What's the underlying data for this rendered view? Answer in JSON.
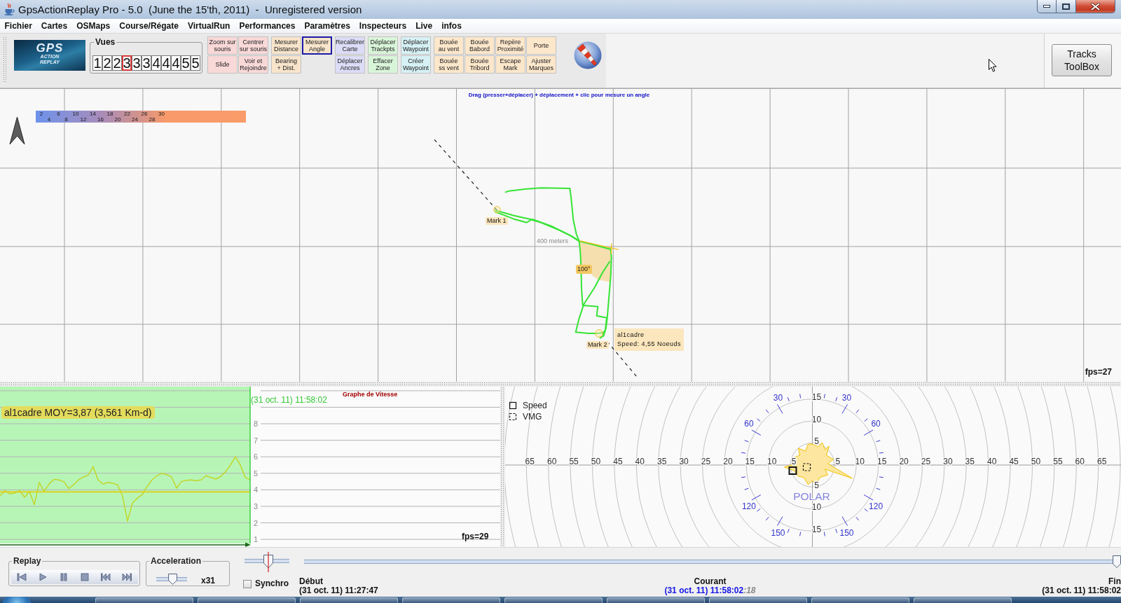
{
  "window": {
    "title": "GpsActionReplay Pro - 5.0  (June the 15'th, 2011)  -  Unregistered version"
  },
  "menu": [
    "Fichier",
    "Cartes",
    "OSMaps",
    "Course/Régate",
    "VirtualRun",
    "Performances",
    "Paramètres",
    "Inspecteurs",
    "Live",
    "infos"
  ],
  "toolbar": {
    "logo": {
      "title": "GPS",
      "subtitle": "ACTION\nREPLAY"
    },
    "views": {
      "label": "Vues",
      "buttons": [
        {
          "label": "1",
          "selected": false
        },
        {
          "label": "2",
          "selected": false
        },
        {
          "label": "2",
          "selected": false
        },
        {
          "label": "3",
          "selected": true
        },
        {
          "label": "3",
          "selected": false
        },
        {
          "label": "3",
          "selected": false
        },
        {
          "label": "4",
          "selected": false
        },
        {
          "label": "4",
          "selected": false
        },
        {
          "label": "4",
          "selected": false
        },
        {
          "label": "5",
          "selected": false
        },
        {
          "label": "5",
          "selected": false
        }
      ]
    },
    "tool_groups": [
      {
        "color": "#f9d8d8",
        "columns": [
          [
            {
              "label": "Zoom sur\nsouris",
              "selected": false
            },
            {
              "label": "Slide",
              "selected": false
            }
          ],
          [
            {
              "label": "Centrer\nsur souris",
              "selected": false
            },
            {
              "label": "Voir et\nRejoindre",
              "selected": false
            }
          ]
        ]
      },
      {
        "color": "#f7e4cb",
        "columns": [
          [
            {
              "label": "Mesurer\nDistance",
              "selected": false
            },
            {
              "label": "Bearing\n+ Dist.",
              "selected": false
            }
          ],
          [
            {
              "label": "Mesurer\nAngle",
              "selected": true
            }
          ]
        ]
      },
      {
        "color": "#dcdcf7",
        "columns": [
          [
            {
              "label": "Recalibrer\nCarte",
              "selected": false
            },
            {
              "label": "Déplacer\nAncres",
              "selected": false
            }
          ]
        ]
      },
      {
        "color": "#d9f5d9",
        "columns": [
          [
            {
              "label": "Déplacer\nTrackpts",
              "selected": false
            },
            {
              "label": "Effacer\nZone",
              "selected": false
            }
          ]
        ]
      },
      {
        "color": "#d6f1f5",
        "columns": [
          [
            {
              "label": "Déplacer\nWaypoint",
              "selected": false
            },
            {
              "label": "Créer\nWaypoint",
              "selected": false
            }
          ]
        ]
      },
      {
        "color": "#fce7cb",
        "columns": [
          [
            {
              "label": "Bouée\nau vent",
              "selected": false
            },
            {
              "label": "Bouée\nss vent",
              "selected": false
            }
          ],
          [
            {
              "label": "Bouée\nBabord",
              "selected": false
            },
            {
              "label": "Bouée\nTribord",
              "selected": false
            }
          ],
          [
            {
              "label": "Repère\nProximité",
              "selected": false
            },
            {
              "label": "Escape\nMark",
              "selected": false
            }
          ],
          [
            {
              "label": "Porte",
              "selected": false
            },
            {
              "label": "Ajuster\nMarques",
              "selected": false
            }
          ]
        ]
      }
    ],
    "toolbox_button": "Tracks\nToolBox"
  },
  "map": {
    "hint": "Drag (presser+déplacer) + déplacement + clic pour mesure un angle",
    "speed_legend": {
      "upper_row": [
        "2",
        "6",
        "10",
        "14",
        "18",
        "22",
        "26",
        "30"
      ],
      "lower_row": [
        "4",
        "8",
        "12",
        "16",
        "20",
        "24",
        "28"
      ]
    },
    "marks": [
      {
        "label": "Mark 1"
      },
      {
        "label": "Mark 2"
      }
    ],
    "scale_label": "400 meters",
    "angle_label": "100°",
    "tooltip": {
      "name": "al1cadre",
      "speed": "Speed: 4,55 Noeuds"
    },
    "fps": "fps=27"
  },
  "speed_graph": {
    "title": "Graphe de Vitesse",
    "label": "al1cadre MOY=3,87 (3,561 Km-d)",
    "time": "(31 oct. 11) 11:58:02",
    "fps": "fps=29",
    "chart_data": {
      "type": "line",
      "grid": true,
      "ylim": [
        0.75,
        10.25
      ],
      "yticks": [
        {
          "value": 1,
          "label": "1"
        },
        {
          "value": 2,
          "label": "2"
        },
        {
          "value": 3,
          "label": "3"
        },
        {
          "value": 4,
          "label": "4"
        },
        {
          "value": 5,
          "label": "5"
        },
        {
          "value": 6,
          "label": "6"
        },
        {
          "value": 7,
          "label": "7"
        },
        {
          "value": 8,
          "label": "8"
        }
      ],
      "series": [
        {
          "color": "#c2d62a",
          "values": [
            3.63,
            3.95,
            3.75,
            3.8,
            3.95,
            3.55,
            3.9,
            3.1,
            4.45,
            3.9,
            4.35,
            4.63,
            4.6,
            4.5,
            4.08,
            4.3,
            4.6,
            4.77,
            4.9,
            5.4,
            4.6,
            4.35,
            4.45,
            4.4,
            4.3,
            3.6,
            2.1,
            3.2,
            3.5,
            3.7,
            4.2,
            4.6,
            4.85,
            5.0,
            4.92,
            4.77,
            4.1,
            4.5,
            4.58,
            4.6,
            4.55,
            4.6,
            4.85,
            4.75,
            4.65,
            4.8,
            5.1,
            5.5,
            6.0,
            5.5,
            4.75,
            4.6,
            null,
            null,
            null,
            null,
            null,
            null,
            null,
            null,
            null,
            null,
            null,
            null,
            null,
            null,
            null,
            null,
            null,
            null,
            null,
            null,
            null,
            null,
            null,
            null,
            null,
            null,
            null,
            null,
            null,
            null,
            null,
            null,
            null,
            null,
            null,
            null,
            null,
            null,
            null,
            null,
            null,
            null,
            null,
            null,
            null,
            null,
            null,
            null,
            null,
            null,
            null
          ]
        },
        {
          "color": "#e2cf10",
          "values": [
            3.87,
            3.87,
            3.87,
            3.87,
            3.87,
            3.87,
            3.87,
            3.87,
            3.87,
            3.87,
            3.87,
            3.87,
            3.87,
            3.87,
            3.87,
            3.87,
            3.87,
            3.87,
            3.87,
            3.87,
            3.87,
            3.87,
            3.87,
            3.87,
            3.87,
            3.87,
            3.87,
            3.87,
            3.87,
            3.87,
            3.87,
            3.87,
            3.87,
            3.87,
            3.87,
            3.87,
            3.87,
            3.87,
            3.87,
            3.87,
            3.87,
            3.87,
            3.87,
            3.87,
            3.87,
            3.87,
            3.87,
            3.87,
            3.87,
            3.87,
            3.87,
            3.87,
            null,
            null,
            null,
            null,
            null,
            null,
            null,
            null,
            null,
            null,
            null,
            null,
            null,
            null,
            null,
            null,
            null,
            null,
            null,
            null,
            null,
            null,
            null,
            null,
            null,
            null,
            null,
            null,
            null,
            null,
            null,
            null,
            null,
            null,
            null,
            null,
            null,
            null,
            null,
            null,
            null,
            null,
            null,
            null,
            null,
            null,
            null,
            null,
            null,
            null,
            null
          ]
        }
      ]
    }
  },
  "polar": {
    "legend": [
      {
        "kind": "solid",
        "label": "Speed"
      },
      {
        "kind": "dashed",
        "label": "VMG"
      }
    ],
    "horizontal_axis_labels": [
      "65",
      "60",
      "55",
      "50",
      "45",
      "40",
      "35",
      "30",
      "25",
      "20",
      "15",
      "10",
      "5",
      "5",
      "10",
      "15",
      "20",
      "25",
      "30",
      "35",
      "40",
      "45",
      "50",
      "55",
      "60",
      "65"
    ],
    "vertical_axis_labels": [
      "15",
      "10",
      "5",
      "5",
      "10",
      "15"
    ],
    "angle_labels": [
      "30",
      "30",
      "60",
      "60",
      "120",
      "120",
      "150",
      "150"
    ],
    "title": "POLAR"
  },
  "controls": {
    "replay": {
      "label": "Replay"
    },
    "acceleration": {
      "label": "Acceleration",
      "level": 0.55,
      "value": "x31"
    },
    "sync_slider": {
      "level": 0.54
    },
    "synchro": {
      "label": "Synchro",
      "checked": false
    },
    "timeline": {
      "level": 1
    },
    "start": {
      "label": "Début",
      "value": "(31 oct. 11) 11:27:47"
    },
    "current": {
      "label": "Courant",
      "value": "(31 oct. 11) 11:58:02",
      "fraction": ":18"
    },
    "end": {
      "label": "Fin",
      "value": "(31 oct. 11) 11:58:02"
    }
  }
}
